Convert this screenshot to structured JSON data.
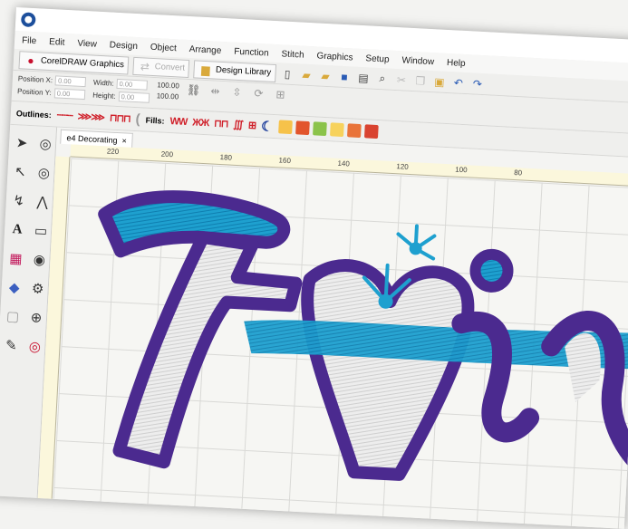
{
  "menu": [
    "File",
    "Edit",
    "View",
    "Design",
    "Object",
    "Arrange",
    "Function",
    "Stitch",
    "Graphics",
    "Setup",
    "Window",
    "Help"
  ],
  "toolbar": {
    "coreldraw_label": "CorelDRAW Graphics",
    "convert_label": "Convert",
    "design_library_label": "Design Library"
  },
  "props": {
    "pos_x_label": "Position X:",
    "pos_y_label": "Position Y:",
    "pos_x_value": "0.00",
    "pos_y_value": "0.00",
    "width_label": "Width:",
    "height_label": "Height:",
    "width_value": "0.00",
    "height_value": "0.00",
    "scale_w": "100.00",
    "scale_h": "100.00"
  },
  "outline_bar": {
    "outlines_label": "Outlines:",
    "fills_label": "Fills:"
  },
  "document": {
    "tab_label": "e4 Decorating",
    "ruler_ticks": [
      "220",
      "200",
      "180",
      "160",
      "140",
      "120",
      "100",
      "80"
    ]
  },
  "colors": {
    "thread_purple": "#4b2a8f",
    "thread_blue": "#1ea0cf",
    "thread_white": "#ededed"
  }
}
